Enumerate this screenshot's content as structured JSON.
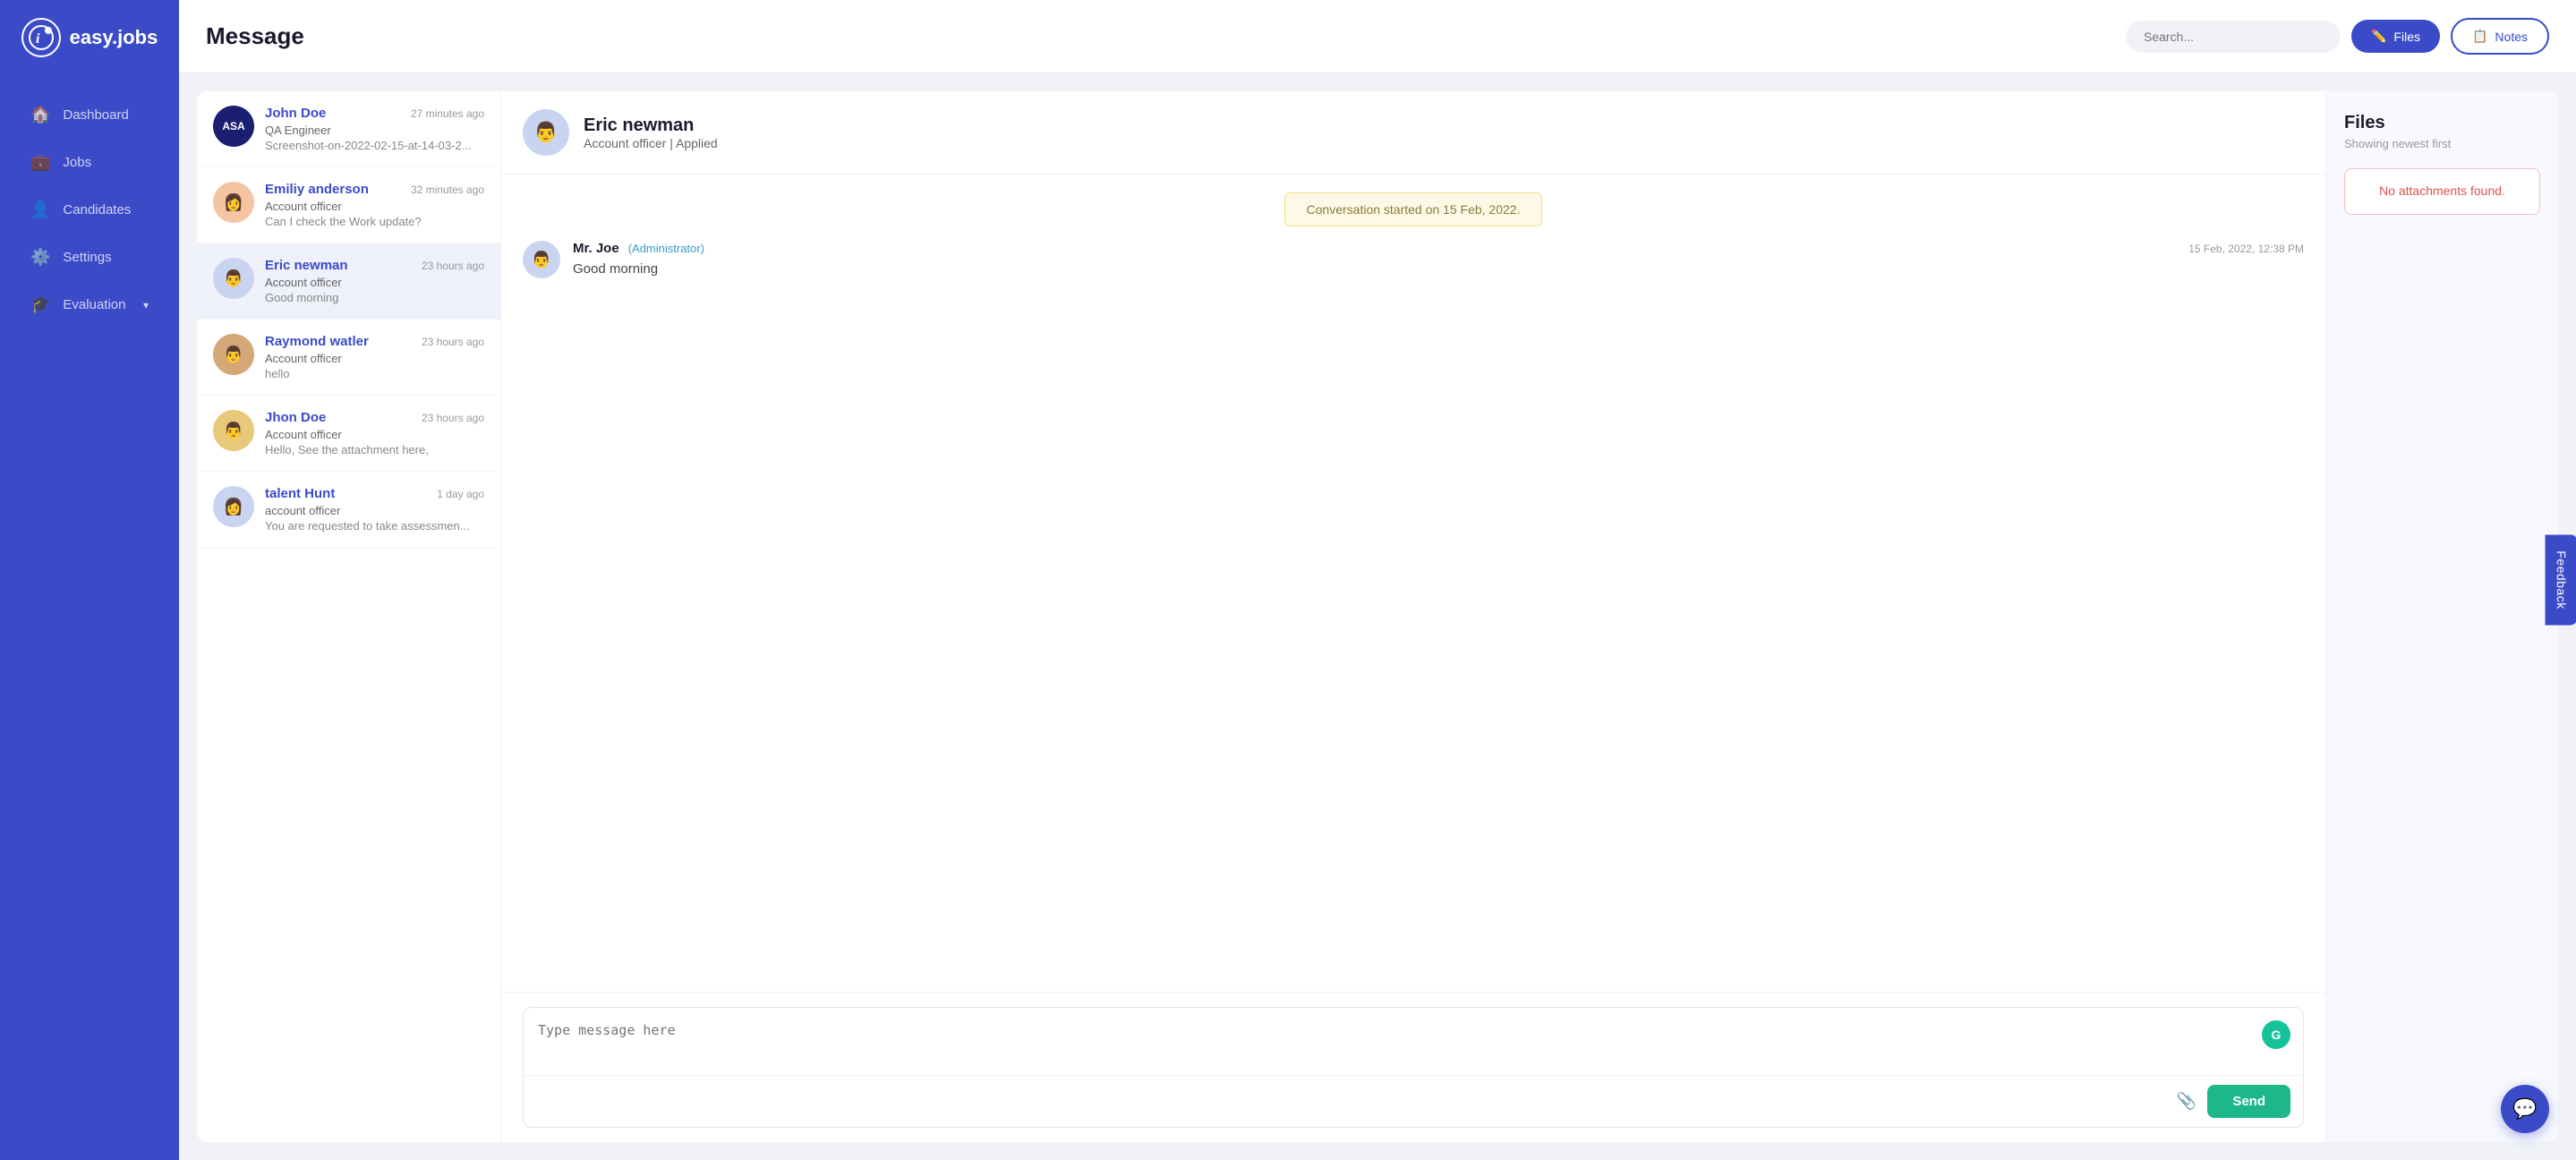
{
  "app": {
    "name": "easy.jobs",
    "logo_text": "i"
  },
  "sidebar": {
    "items": [
      {
        "id": "dashboard",
        "label": "Dashboard",
        "icon": "🏠",
        "active": false
      },
      {
        "id": "jobs",
        "label": "Jobs",
        "icon": "💼",
        "active": false
      },
      {
        "id": "candidates",
        "label": "Candidates",
        "icon": "👤",
        "active": false
      },
      {
        "id": "settings",
        "label": "Settings",
        "icon": "⚙️",
        "active": false
      },
      {
        "id": "evaluation",
        "label": "Evaluation",
        "icon": "🎓",
        "active": false,
        "has_chevron": true
      }
    ]
  },
  "header": {
    "title": "Message",
    "search_placeholder": "Search...",
    "btn_files_label": "Files",
    "btn_notes_label": "Notes"
  },
  "conversations": [
    {
      "id": "john-doe",
      "name": "John Doe",
      "role": "QA Engineer",
      "preview": "Screenshot-on-2022-02-15-at-14-03-2...",
      "time": "27 minutes ago",
      "avatar_type": "asa",
      "avatar_text": "ASA",
      "active": false
    },
    {
      "id": "emiliy-anderson",
      "name": "Emiliy anderson",
      "role": "Account officer",
      "preview": "Can I check the Work update?",
      "time": "32 minutes ago",
      "avatar_type": "emily",
      "avatar_emoji": "👩",
      "active": false
    },
    {
      "id": "eric-newman",
      "name": "Eric newman",
      "role": "Account officer",
      "preview": "Good morning",
      "time": "23 hours ago",
      "avatar_type": "eric",
      "avatar_emoji": "👨",
      "active": true
    },
    {
      "id": "raymond-watler",
      "name": "Raymond watler",
      "role": "Account officer",
      "preview": "hello",
      "time": "23 hours ago",
      "avatar_type": "raymond",
      "avatar_emoji": "👨",
      "active": false
    },
    {
      "id": "jhon-doe",
      "name": "Jhon Doe",
      "role": "Account officer",
      "preview": "Hello, See the attachment here,",
      "time": "23 hours ago",
      "avatar_type": "jhon",
      "avatar_emoji": "👨",
      "active": false
    },
    {
      "id": "talent-hunt",
      "name": "talent Hunt",
      "role": "account officer",
      "preview": "You are requested to take assessmen...",
      "time": "1 day ago",
      "avatar_type": "talent",
      "avatar_emoji": "👩",
      "active": false
    }
  ],
  "chat": {
    "user_name": "Eric newman",
    "user_role": "Account officer",
    "applied_status": "Applied",
    "conversation_started_notice": "Conversation started on 15 Feb, 2022.",
    "messages": [
      {
        "id": "msg1",
        "sender": "Mr. Joe",
        "badge": "(Administrator)",
        "time": "15 Feb, 2022, 12:38 PM",
        "text": "Good morning",
        "avatar_emoji": "👨"
      }
    ],
    "input_placeholder": "Type message here",
    "send_label": "Send"
  },
  "files_panel": {
    "title": "Files",
    "subtitle": "Showing newest first",
    "no_attachments_text": "No attachments found."
  },
  "feedback": {
    "label": "Feedback"
  }
}
